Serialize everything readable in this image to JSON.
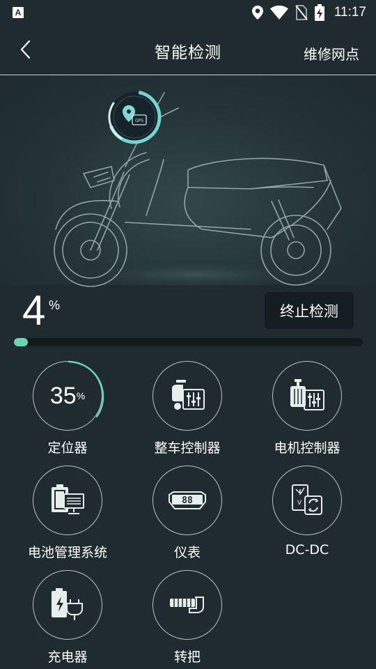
{
  "status_bar": {
    "app_badge": "A",
    "time": "11:17",
    "icons": [
      "location-icon",
      "wifi-icon",
      "no-sim-icon",
      "battery-charging-icon"
    ]
  },
  "header": {
    "back_icon": "chevron-left-icon",
    "title": "智能检测",
    "repair_link": "维修网点"
  },
  "hero": {
    "image": "electric-scooter-outline",
    "gps_badge": {
      "icon": "gps-chip-icon",
      "text": "GPS"
    }
  },
  "progress": {
    "value": "4",
    "unit": "%",
    "fraction": 0.04,
    "stop_button": "终止检测"
  },
  "colors": {
    "background": "#1f2b2e",
    "accent": "#68d6b5",
    "button_bg": "#141d1f"
  },
  "items": [
    {
      "label": "定位器",
      "progress": "35",
      "unit": "%",
      "progress_fraction": 0.35,
      "state": "checking"
    },
    {
      "label": "整车控制器",
      "icon": "vehicle-controller-icon",
      "state": "pending"
    },
    {
      "label": "电机控制器",
      "icon": "motor-controller-icon",
      "state": "pending"
    },
    {
      "label": "电池管理系统",
      "icon": "battery-management-icon",
      "state": "pending"
    },
    {
      "label": "仪表",
      "icon": "dashboard-meter-icon",
      "state": "pending",
      "meter_text": "88"
    },
    {
      "label": "DC-DC",
      "icon": "dc-dc-converter-icon",
      "state": "pending"
    },
    {
      "label": "充电器",
      "icon": "charger-icon",
      "state": "pending"
    },
    {
      "label": "转把",
      "icon": "throttle-grip-icon",
      "state": "pending"
    }
  ]
}
